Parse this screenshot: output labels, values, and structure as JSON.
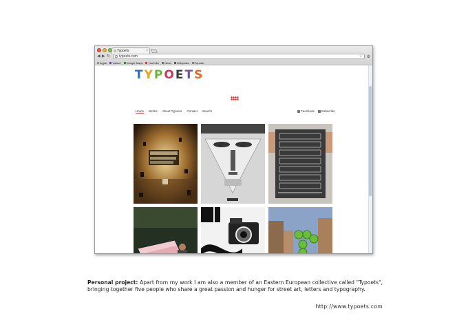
{
  "browser": {
    "tab_title": "Typoets",
    "url": "typoets.com",
    "bookmarks": [
      {
        "label": "Apple",
        "color": "#8a8a8a"
      },
      {
        "label": "Yahoo!",
        "color": "#7b2fa0"
      },
      {
        "label": "Google Maps",
        "color": "#3b7a3b"
      },
      {
        "label": "YouTube",
        "color": "#d0312d"
      },
      {
        "label": "News",
        "color": "#6a6a6a"
      },
      {
        "label": "Wikipedia",
        "color": "#4a4a4a"
      },
      {
        "label": "Popular",
        "color": "#7a7a7a"
      }
    ]
  },
  "site": {
    "logo_letters": [
      "T",
      "Y",
      "P",
      "O",
      "E",
      "T",
      "S"
    ],
    "logo_colors": [
      "#2f6fb3",
      "#e0a322",
      "#6bb43f",
      "#c23b5a",
      "#3d3d3d",
      "#7a4fa3",
      "#e06a2a"
    ],
    "nav": [
      "Home",
      "Works",
      "About Typoets",
      "Contact",
      "Search"
    ],
    "social": [
      "Facebook",
      "Subscribe"
    ]
  },
  "caption": {
    "lead": "Personal project:",
    "text": " Apart from my work I am also a member of an Eastern European collective called \"Typoets\", bringing together five people who share a great passion and hunger for street art, letters and typography.",
    "url": "http://www.typoets.com"
  }
}
